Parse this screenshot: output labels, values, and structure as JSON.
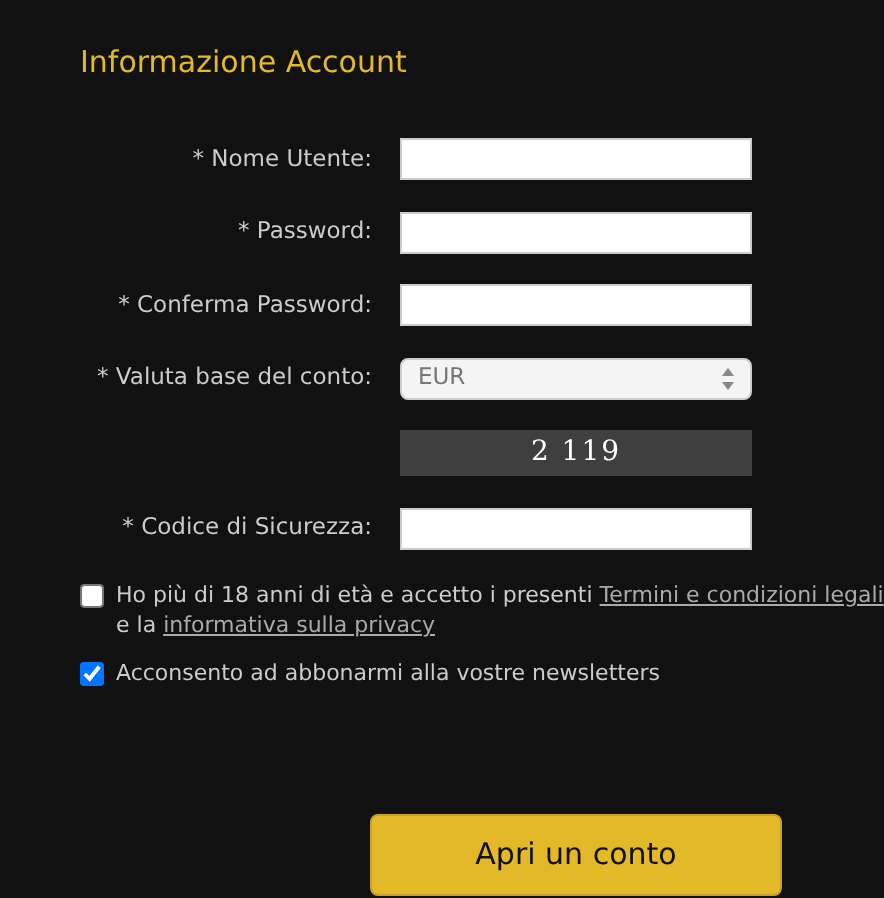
{
  "title": "Informazione Account",
  "fields": [
    {
      "kind": "text",
      "label": "* Nome Utente:"
    },
    {
      "kind": "text",
      "label": "* Password:"
    },
    {
      "kind": "text",
      "label": "* Conferma Password:"
    },
    {
      "kind": "select",
      "label": "* Valuta base del conto:",
      "value": "EUR"
    },
    {
      "kind": "captcha",
      "value": "2 119"
    },
    {
      "kind": "text",
      "label": "* Codice di Sicurezza:"
    }
  ],
  "consents": [
    {
      "checked": false,
      "text": "Ho più di 18 anni di età e accetto i presenti",
      "link": "Termini e condizioni legali",
      "text_after": "e la",
      "link_2": "informativa sulla privacy"
    },
    {
      "checked": true,
      "text": "Acconsento ad abbonarmi alla vostre newsletters"
    }
  ],
  "submit": "Apri un conto"
}
